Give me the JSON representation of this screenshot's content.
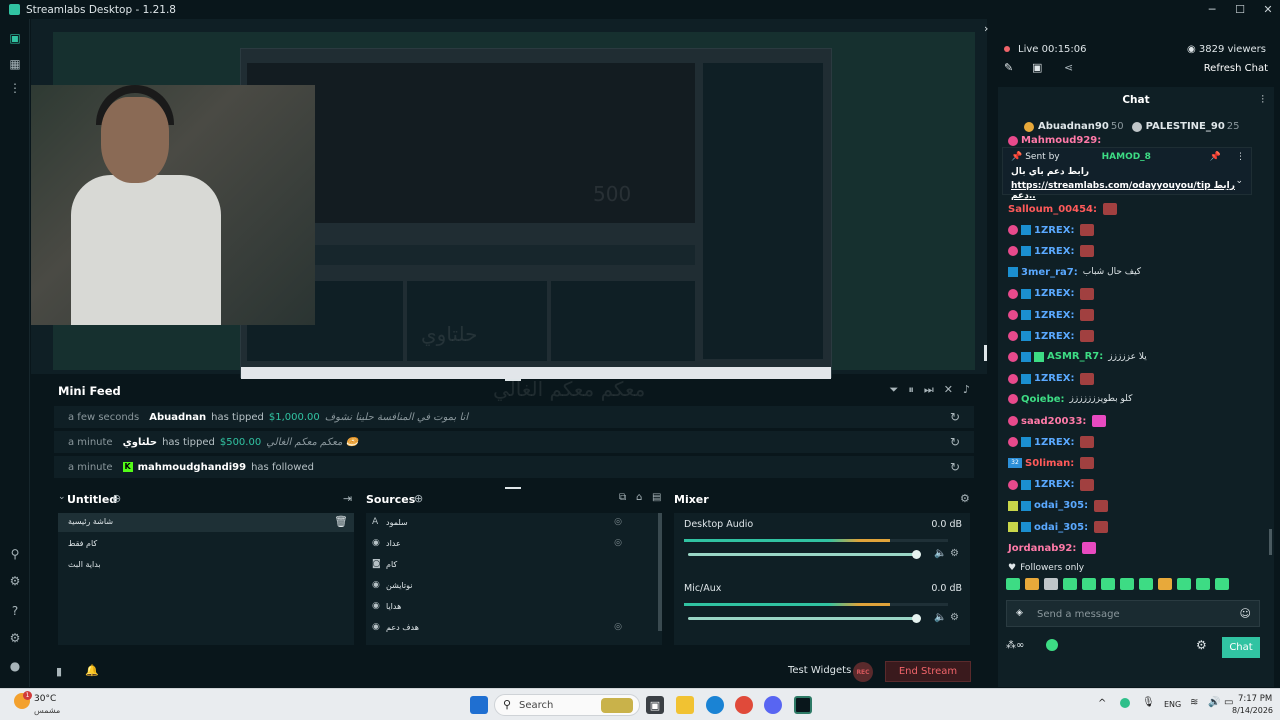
{
  "window": {
    "title": "Streamlabs Desktop - 1.21.8"
  },
  "canvas": {
    "overlay_amount": "500",
    "overlay_text_1": "معكم معكم الغالي",
    "overlay_text_2": "حلتاوي"
  },
  "minifeed": {
    "title": "Mini Feed",
    "rows": [
      {
        "time": "a few seconds",
        "user": "Abuadnan",
        "action": "has tipped",
        "amount": "$1,000.00",
        "message": "انا بموت في المنافسة حلينا نشوف"
      },
      {
        "time": "a minute",
        "user": "حلتاوي",
        "action": "has tipped",
        "amount": "$500.00",
        "message": "معكم معكم الغالي 🥯"
      },
      {
        "time": "a minute",
        "user": "mahmoudghandi99",
        "action": "has followed",
        "amount": "",
        "message": ""
      }
    ]
  },
  "scenes": {
    "title": "Untitled",
    "items": [
      "شاشة رئيسية",
      "كام فقط",
      "بداية البث"
    ]
  },
  "sources": {
    "title": "Sources",
    "items": [
      "سلمود",
      "عداد",
      "كام",
      "نوتايشن",
      "هدايا",
      "هدف دعم"
    ]
  },
  "mixer": {
    "title": "Mixer",
    "channels": [
      {
        "name": "Desktop Audio",
        "db": "0.0 dB",
        "level": 0.78,
        "volume": 1.0
      },
      {
        "name": "Mic/Aux",
        "db": "0.0 dB",
        "level": 0.78,
        "volume": 1.0
      }
    ]
  },
  "bottombar": {
    "test_widgets": "Test Widgets",
    "rec_label": "REC",
    "end_stream": "End Stream"
  },
  "stream": {
    "live_label": "Live 00:15:06",
    "viewers": "3829 viewers",
    "refresh_chat": "Refresh Chat"
  },
  "chat": {
    "title": "Chat",
    "leaderboard": [
      {
        "name": "Abuadnan90",
        "score": "50"
      },
      {
        "name": "PALESTINE_90",
        "score": "25"
      }
    ],
    "partial_user": "Mahmoud929:",
    "pinned": {
      "sent_by_label": "Sent by",
      "sender": "HAMOD_8",
      "line1": "رابط دعم باي بال",
      "line2": "https://streamlabs.com/odayyouyou/tip رابط دعم.."
    },
    "messages": [
      {
        "user": "Salloum_00454:",
        "text": "",
        "color": "#ff5a5a",
        "badges": []
      },
      {
        "user": "1ZREX:",
        "text": "",
        "color": "#5aa9ff",
        "badges": [
          "sub",
          "prime"
        ]
      },
      {
        "user": "1ZREX:",
        "text": "",
        "color": "#5aa9ff",
        "badges": [
          "sub",
          "prime"
        ]
      },
      {
        "user": "3mer_ra7:",
        "text": "كيف حال شباب",
        "color": "#5aa9ff",
        "badges": [
          "prime"
        ]
      },
      {
        "user": "1ZREX:",
        "text": "",
        "color": "#5aa9ff",
        "badges": [
          "sub",
          "prime"
        ]
      },
      {
        "user": "1ZREX:",
        "text": "",
        "color": "#5aa9ff",
        "badges": [
          "sub",
          "prime"
        ]
      },
      {
        "user": "1ZREX:",
        "text": "",
        "color": "#5aa9ff",
        "badges": [
          "sub",
          "prime"
        ]
      },
      {
        "user": "ASMR_R7:",
        "text": "يلا عززززز",
        "color": "#3ddc84",
        "badges": [
          "sub",
          "prime",
          "vip"
        ]
      },
      {
        "user": "1ZREX:",
        "text": "",
        "color": "#5aa9ff",
        "badges": [
          "sub",
          "prime"
        ]
      },
      {
        "user": "Qoiebe:",
        "text": "كلو بطويززززززز",
        "color": "#3ddc84",
        "badges": [
          "sub"
        ]
      },
      {
        "user": "saad20033:",
        "text": "",
        "color": "#ff7aa8",
        "badges": [
          "sub"
        ]
      },
      {
        "user": "1ZREX:",
        "text": "",
        "color": "#5aa9ff",
        "badges": [
          "sub",
          "prime"
        ]
      },
      {
        "user": "S0liman:",
        "text": "",
        "color": "#ff5a5a",
        "badges": [
          "32"
        ]
      },
      {
        "user": "1ZREX:",
        "text": "",
        "color": "#5aa9ff",
        "badges": [
          "sub",
          "prime"
        ]
      },
      {
        "user": "odai_305:",
        "text": "",
        "color": "#5aa9ff",
        "badges": [
          "bits",
          "prime"
        ]
      },
      {
        "user": "odai_305:",
        "text": "",
        "color": "#5aa9ff",
        "badges": [
          "bits",
          "prime"
        ]
      },
      {
        "user": "Jordanab92:",
        "text": "",
        "color": "#ff7aa8",
        "badges": []
      }
    ],
    "followers_only": "Followers only",
    "input_placeholder": "Send a message",
    "send_label": "Chat"
  },
  "taskbar": {
    "temp": "30°C",
    "weather_sub": "مشمس",
    "search": "Search",
    "lang": "ENG",
    "time": "7:17 PM",
    "date": "8/14/2026",
    "notif_count": "1"
  }
}
